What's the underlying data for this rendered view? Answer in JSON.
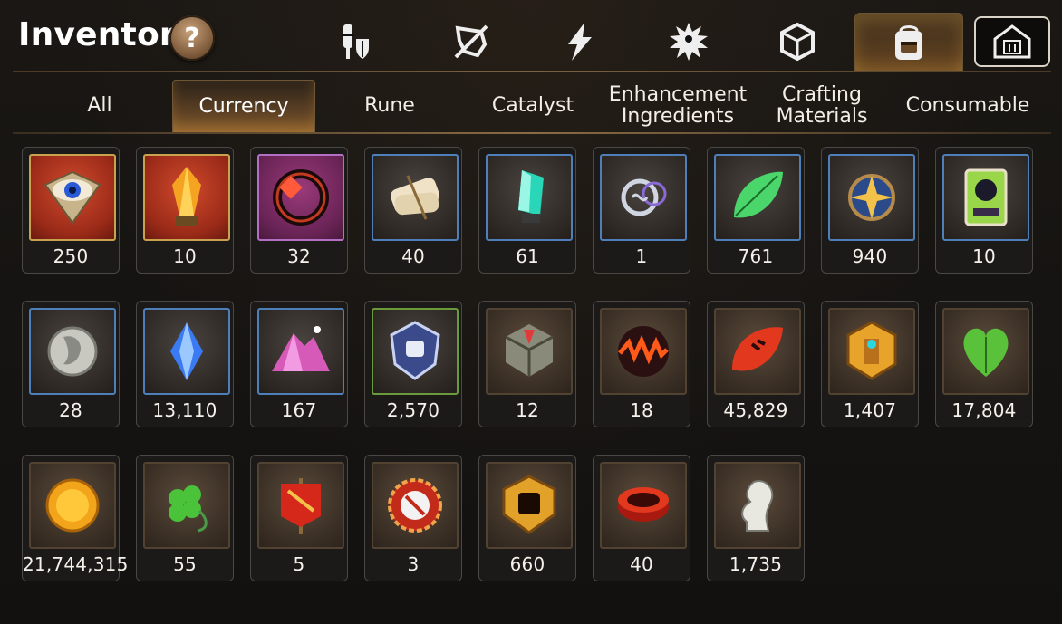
{
  "header": {
    "title": "Inventory",
    "help_label": "?"
  },
  "top_tabs": [
    {
      "icon": "knight-helmet-shield-icon",
      "active": false
    },
    {
      "icon": "crossed-out-shield-icon",
      "active": false
    },
    {
      "icon": "lightning-icon",
      "active": false
    },
    {
      "icon": "burst-figure-icon",
      "active": false
    },
    {
      "icon": "cube-dice-icon",
      "active": false
    },
    {
      "icon": "backpack-icon",
      "active": true
    },
    {
      "icon": "storehouse-icon",
      "active": false
    }
  ],
  "category_tabs": [
    {
      "label": "All",
      "active": false
    },
    {
      "label": "Currency",
      "active": true
    },
    {
      "label": "Rune",
      "active": false
    },
    {
      "label": "Catalyst",
      "active": false
    },
    {
      "label": "Enhancement Ingredients",
      "active": false
    },
    {
      "label": "Crafting Materials",
      "active": false
    },
    {
      "label": "Consumable",
      "active": false
    }
  ],
  "items": [
    {
      "qty": "250",
      "icon": "eye-emblem-icon",
      "frame": "gold"
    },
    {
      "qty": "10",
      "icon": "golden-crystal-icon",
      "frame": "gold"
    },
    {
      "qty": "32",
      "icon": "red-ring-icon",
      "frame": "purple"
    },
    {
      "qty": "40",
      "icon": "scroll-bundle-icon",
      "frame": "blue"
    },
    {
      "qty": "61",
      "icon": "teal-crystal-icon",
      "frame": "blue"
    },
    {
      "qty": "1",
      "icon": "silver-pendant-icon",
      "frame": "blue"
    },
    {
      "qty": "761",
      "icon": "green-leaf-icon",
      "frame": "blue"
    },
    {
      "qty": "940",
      "icon": "star-amulet-icon",
      "frame": "blue"
    },
    {
      "qty": "10",
      "icon": "ticket-card-icon",
      "frame": "blue"
    },
    {
      "qty": "28",
      "icon": "silver-coin-icon",
      "frame": "blue"
    },
    {
      "qty": "13,110",
      "icon": "blue-gem-icon",
      "frame": "blue"
    },
    {
      "qty": "167",
      "icon": "pink-mountain-icon",
      "frame": "blue"
    },
    {
      "qty": "2,570",
      "icon": "fist-crest-icon",
      "frame": "green"
    },
    {
      "qty": "12",
      "icon": "stone-cube-icon",
      "frame": "none"
    },
    {
      "qty": "18",
      "icon": "fire-orb-icon",
      "frame": "none"
    },
    {
      "qty": "45,829",
      "icon": "red-leaf-icon",
      "frame": "none"
    },
    {
      "qty": "1,407",
      "icon": "golden-hex-crest-icon",
      "frame": "none"
    },
    {
      "qty": "17,804",
      "icon": "green-heart-icon",
      "frame": "none"
    },
    {
      "qty": "21,744,315",
      "icon": "gold-coin-icon",
      "frame": "none"
    },
    {
      "qty": "55",
      "icon": "clover-charm-icon",
      "frame": "none"
    },
    {
      "qty": "5",
      "icon": "war-banner-icon",
      "frame": "none"
    },
    {
      "qty": "3",
      "icon": "red-seal-badge-icon",
      "frame": "none"
    },
    {
      "qty": "660",
      "icon": "fist-medal-icon",
      "frame": "none"
    },
    {
      "qty": "40",
      "icon": "red-bracelet-icon",
      "frame": "none"
    },
    {
      "qty": "1,735",
      "icon": "chess-knight-icon",
      "frame": "none"
    }
  ]
}
